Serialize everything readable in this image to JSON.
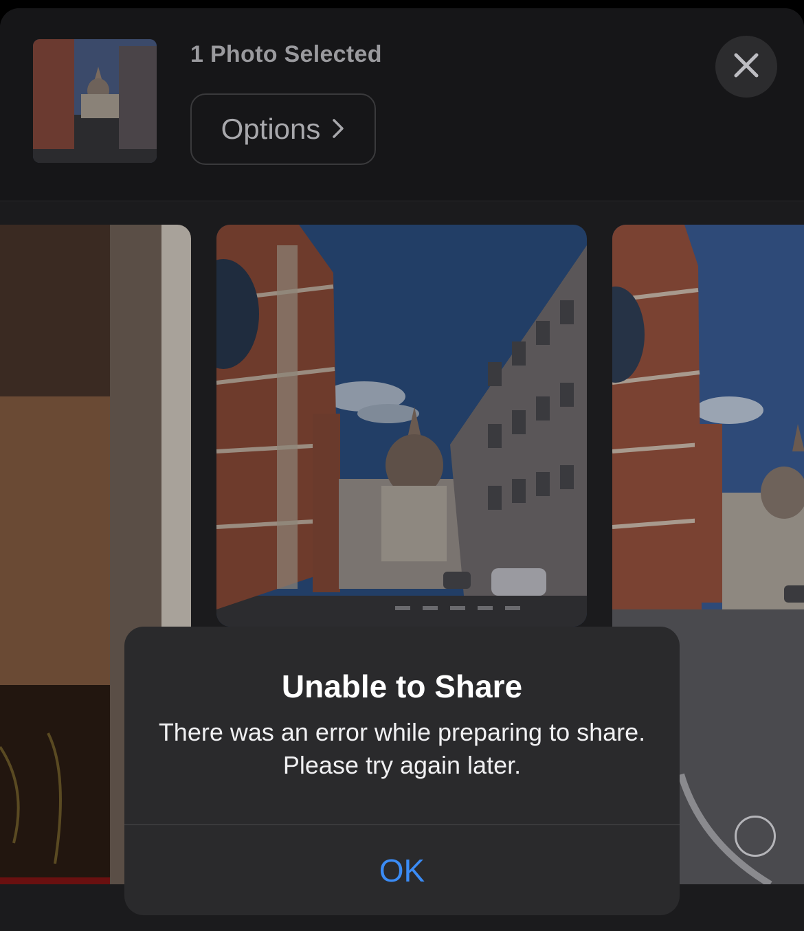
{
  "header": {
    "title": "1 Photo Selected",
    "options_label": "Options",
    "close_label": "Close"
  },
  "alert": {
    "title": "Unable to Share",
    "message": "There was an error while preparing to share. Please try again later.",
    "ok_label": "OK",
    "ok_color": "#3b8cf6"
  },
  "icons": {
    "close": "xmark-icon",
    "options_chevron": "chevron-right-icon",
    "select": "selection-circle-icon"
  }
}
